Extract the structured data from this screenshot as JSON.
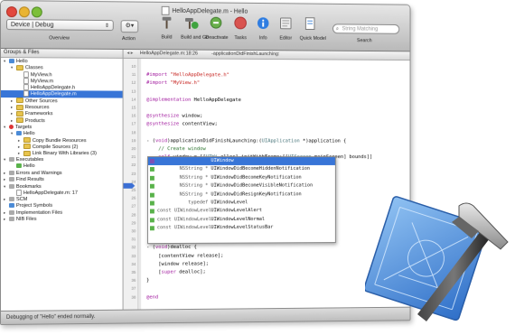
{
  "window": {
    "title": "HelloAppDelegate.m - Hello",
    "colors": {
      "selection": "#3875d7",
      "keyword": "#a1199e",
      "string": "#c41a16",
      "comment": "#236e25"
    }
  },
  "toolbar": {
    "device_popup": "Device | Debug",
    "overview_label": "Overview",
    "action_label": "Action",
    "items": [
      {
        "label": "Build",
        "icon": "hammer-icon"
      },
      {
        "label": "Build and Go",
        "icon": "build-go-icon"
      },
      {
        "label": "Deactivate",
        "icon": "deactivate-icon"
      },
      {
        "label": "Tasks",
        "icon": "stop-icon"
      },
      {
        "label": "Info",
        "icon": "info-icon"
      },
      {
        "label": "Editor",
        "icon": "editor-icon"
      },
      {
        "label": "Quick Model",
        "icon": "model-icon"
      }
    ],
    "search_placeholder": "String Matching",
    "search_label": "Search"
  },
  "sidebar": {
    "header": "Groups & Files",
    "items": [
      {
        "label": "Hello",
        "indent": 0,
        "icon": "project",
        "tri": "▾"
      },
      {
        "label": "Classes",
        "indent": 1,
        "icon": "folder",
        "tri": "▾"
      },
      {
        "label": "MyView.h",
        "indent": 2,
        "icon": "file",
        "tri": ""
      },
      {
        "label": "MyView.m",
        "indent": 2,
        "icon": "file",
        "tri": ""
      },
      {
        "label": "HelloAppDelegate.h",
        "indent": 2,
        "icon": "file",
        "tri": ""
      },
      {
        "label": "HelloAppDelegate.m",
        "indent": 2,
        "icon": "file",
        "tri": "",
        "selected": true
      },
      {
        "label": "Other Sources",
        "indent": 1,
        "icon": "folder",
        "tri": "▸"
      },
      {
        "label": "Resources",
        "indent": 1,
        "icon": "folder",
        "tri": "▸"
      },
      {
        "label": "Frameworks",
        "indent": 1,
        "icon": "folder",
        "tri": "▸"
      },
      {
        "label": "Products",
        "indent": 1,
        "icon": "folder",
        "tri": "▸"
      },
      {
        "label": "Targets",
        "indent": 0,
        "icon": "target",
        "tri": "▾"
      },
      {
        "label": "Hello",
        "indent": 1,
        "icon": "blue",
        "tri": "▾"
      },
      {
        "label": "Copy Bundle Resources",
        "indent": 2,
        "icon": "folder",
        "tri": "▸"
      },
      {
        "label": "Compile Sources (2)",
        "indent": 2,
        "icon": "folder",
        "tri": "▸"
      },
      {
        "label": "Link Binary With Libraries (3)",
        "indent": 2,
        "icon": "folder",
        "tri": "▸"
      },
      {
        "label": "Executables",
        "indent": 0,
        "icon": "gray",
        "tri": "▾"
      },
      {
        "label": "Hello",
        "indent": 1,
        "icon": "green",
        "tri": ""
      },
      {
        "label": "Errors and Warnings",
        "indent": 0,
        "icon": "gray",
        "tri": "▸"
      },
      {
        "label": "Find Results",
        "indent": 0,
        "icon": "gray",
        "tri": "▸"
      },
      {
        "label": "Bookmarks",
        "indent": 0,
        "icon": "gray",
        "tri": "▾"
      },
      {
        "label": "HelloAppDelegate.m: 17",
        "indent": 1,
        "icon": "file",
        "tri": ""
      },
      {
        "label": "SCM",
        "indent": 0,
        "icon": "gray",
        "tri": "▸"
      },
      {
        "label": "Project Symbols",
        "indent": 0,
        "icon": "blue",
        "tri": ""
      },
      {
        "label": "Implementation Files",
        "indent": 0,
        "icon": "gray",
        "tri": "▸"
      },
      {
        "label": "NIB Files",
        "indent": 0,
        "icon": "gray",
        "tri": "▸"
      }
    ]
  },
  "editor_nav": {
    "file": "HelloAppDelegate.m:18:26",
    "symbol": "-applicationDidFinishLaunching:"
  },
  "code_lines": [
    "",
    "#import \"HelloAppDelegate.h\"",
    "#import \"MyView.h\"",
    "",
    "@implementation HelloAppDelegate",
    "",
    "@synthesize window;",
    "@synthesize contentView;",
    "",
    "- (void)applicationDidFinishLaunching:(UIApplication *)application {",
    "    // Create window",
    "    self.window = [[UIWi alloc] initWithFrame:[[UIScreen mainScreen] bounds]]",
    "",
    "",
    "                                                  mainScreen]",
    "",
    "",
    "",
    "",
    "",
    "",
    "",
    "- (void)dealloc {",
    "    [contentView release];",
    "    [window release];",
    "    [super dealloc];",
    "}",
    "",
    "@end"
  ],
  "line_numbers": [
    "10",
    "11",
    "12",
    "13",
    "14",
    "15",
    "16",
    "17",
    "18",
    "19",
    "20",
    "21",
    "22",
    "23",
    "24",
    "25",
    "26",
    "27",
    "28",
    "29",
    "30",
    "31",
    "32",
    "33",
    "34",
    "35",
    "36",
    "37",
    "38"
  ],
  "autocomplete": [
    {
      "type": "",
      "name": "UIWindow",
      "kind": "class",
      "selected": true
    },
    {
      "type": "NSString *",
      "name": "UIWindowDidBecomeHiddenNotification",
      "kind": "const"
    },
    {
      "type": "NSString *",
      "name": "UIWindowDidBecomeKeyNotification",
      "kind": "const"
    },
    {
      "type": "NSString *",
      "name": "UIWindowDidBecomeVisibleNotification",
      "kind": "const"
    },
    {
      "type": "NSString *",
      "name": "UIWindowDidResignKeyNotification",
      "kind": "const"
    },
    {
      "type": "typedef",
      "name": "UIWindowLevel",
      "kind": "typedef"
    },
    {
      "type": "const UIWindowLevel",
      "name": "UIWindowLevelAlert",
      "kind": "const"
    },
    {
      "type": "const UIWindowLevel",
      "name": "UIWindowLevelNormal",
      "kind": "const"
    },
    {
      "type": "const UIWindowLevel",
      "name": "UIWindowLevelStatusBar",
      "kind": "const"
    }
  ],
  "status": "Debugging of \"Hello\" ended normally."
}
